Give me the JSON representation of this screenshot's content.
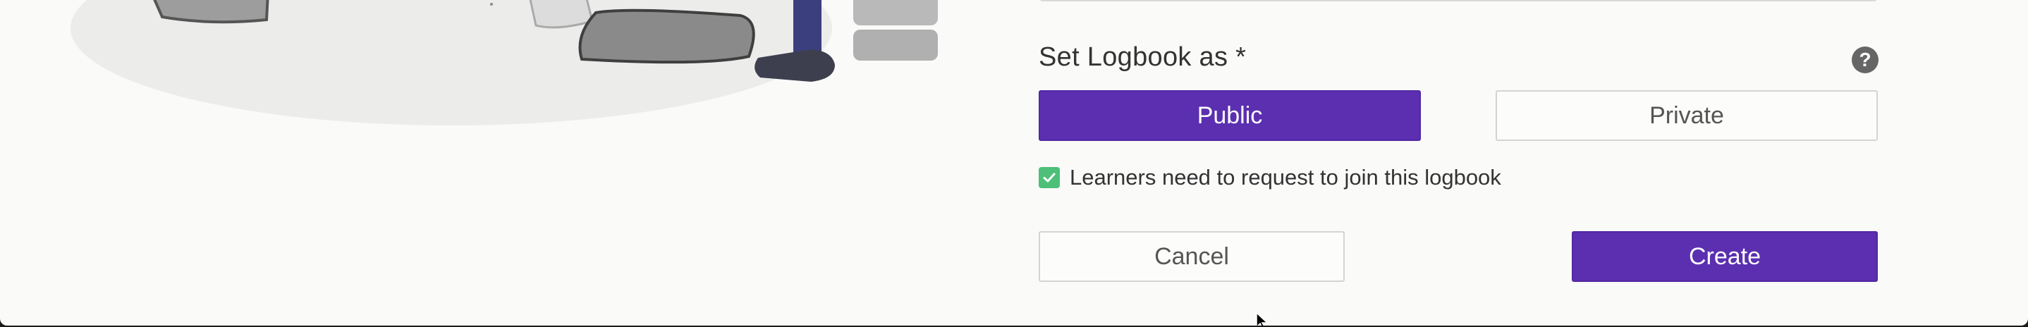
{
  "form": {
    "set_label": "Set Logbook as *",
    "help_glyph": "?",
    "visibility_options": {
      "public_label": "Public",
      "private_label": "Private",
      "selected": "Public"
    },
    "join_request": {
      "label": "Learners need to request to join this logbook",
      "checked": true
    },
    "cancel_label": "Cancel",
    "create_label": "Create"
  },
  "colors": {
    "primary": "#5b2fb0",
    "checkbox": "#4dbf78",
    "background": "#fafaf9"
  },
  "icons": {
    "help": "question-circle-icon",
    "check": "checkmark-icon"
  }
}
